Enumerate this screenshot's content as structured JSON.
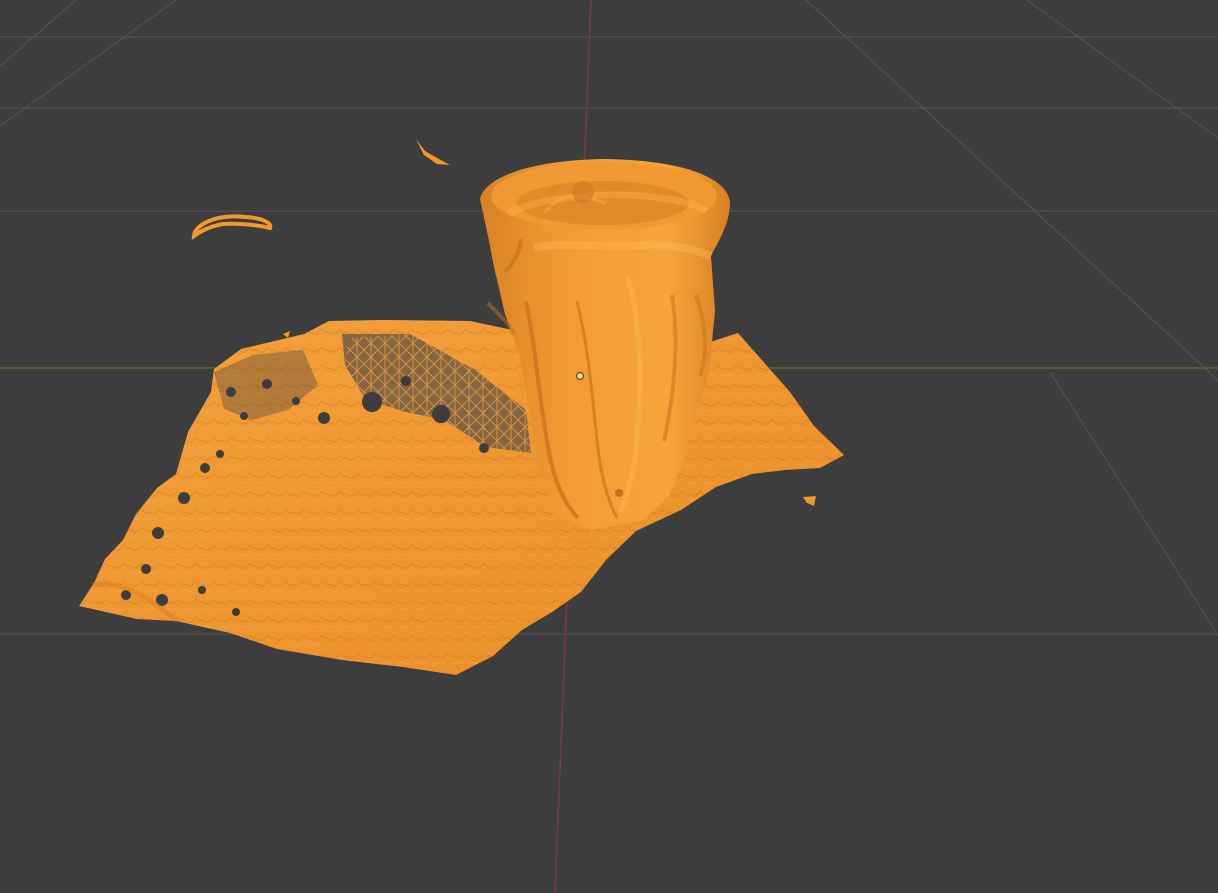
{
  "viewport": {
    "kind": "3D viewport",
    "background_color": "#3d3d3d",
    "grid_color": "#555555",
    "x_axis_color": "#7a3a3f",
    "y_axis_color": "#6b8a37",
    "selected_object_color": "#f3982b",
    "origin_dot_color": "#f3982b"
  },
  "object": {
    "name": "",
    "selected": true,
    "description_hidden": "",
    "icon": "mesh-object-icon"
  }
}
